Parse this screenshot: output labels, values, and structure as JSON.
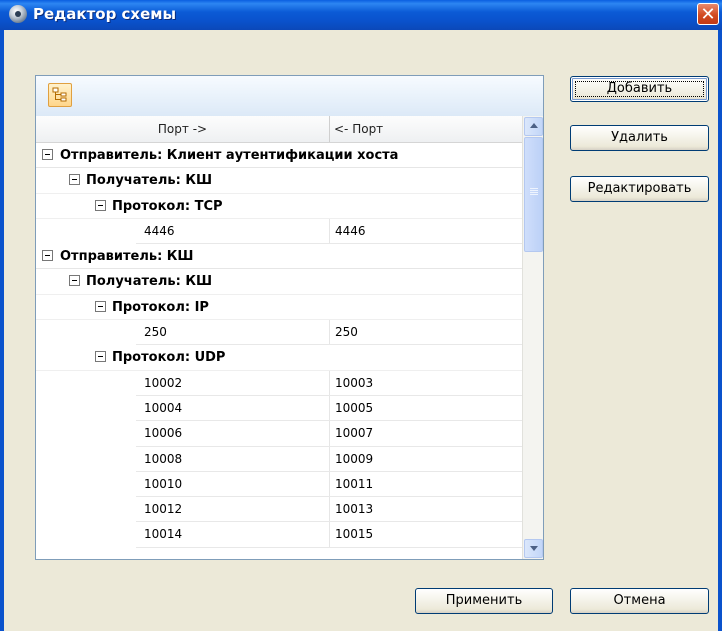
{
  "window": {
    "title": "Редактор схемы",
    "close_glyph": "✕"
  },
  "grid": {
    "columns": [
      "Порт ->",
      "<- Порт"
    ],
    "rows": [
      {
        "type": "group",
        "level": 0,
        "label": "Отправитель: Клиент аутентификации хоста"
      },
      {
        "type": "group",
        "level": 1,
        "label": "Получатель: КШ"
      },
      {
        "type": "group",
        "level": 2,
        "label": "Протокол: TCP"
      },
      {
        "type": "data",
        "c1": "4446",
        "c2": "4446"
      },
      {
        "type": "group",
        "level": 0,
        "label": "Отправитель: КШ"
      },
      {
        "type": "group",
        "level": 1,
        "label": "Получатель: КШ"
      },
      {
        "type": "group",
        "level": 2,
        "label": "Протокол: IP"
      },
      {
        "type": "data",
        "c1": "250",
        "c2": "250"
      },
      {
        "type": "group",
        "level": 2,
        "label": "Протокол: UDP"
      },
      {
        "type": "data",
        "c1": "10002",
        "c2": "10003"
      },
      {
        "type": "data",
        "c1": "10004",
        "c2": "10005"
      },
      {
        "type": "data",
        "c1": "10006",
        "c2": "10007"
      },
      {
        "type": "data",
        "c1": "10008",
        "c2": "10009"
      },
      {
        "type": "data",
        "c1": "10010",
        "c2": "10011"
      },
      {
        "type": "data",
        "c1": "10012",
        "c2": "10013"
      },
      {
        "type": "data",
        "c1": "10014",
        "c2": "10015"
      }
    ]
  },
  "buttons": {
    "add": "Добавить",
    "delete": "Удалить",
    "edit": "Редактировать",
    "apply": "Применить",
    "cancel": "Отмена"
  },
  "colors": {
    "title_bar": "#0a52cc",
    "close": "#d24a22",
    "toolbar_button": "#ffd68a"
  },
  "icons": {
    "window": "app-gear-icon",
    "toolbar": "tree-view-icon"
  }
}
